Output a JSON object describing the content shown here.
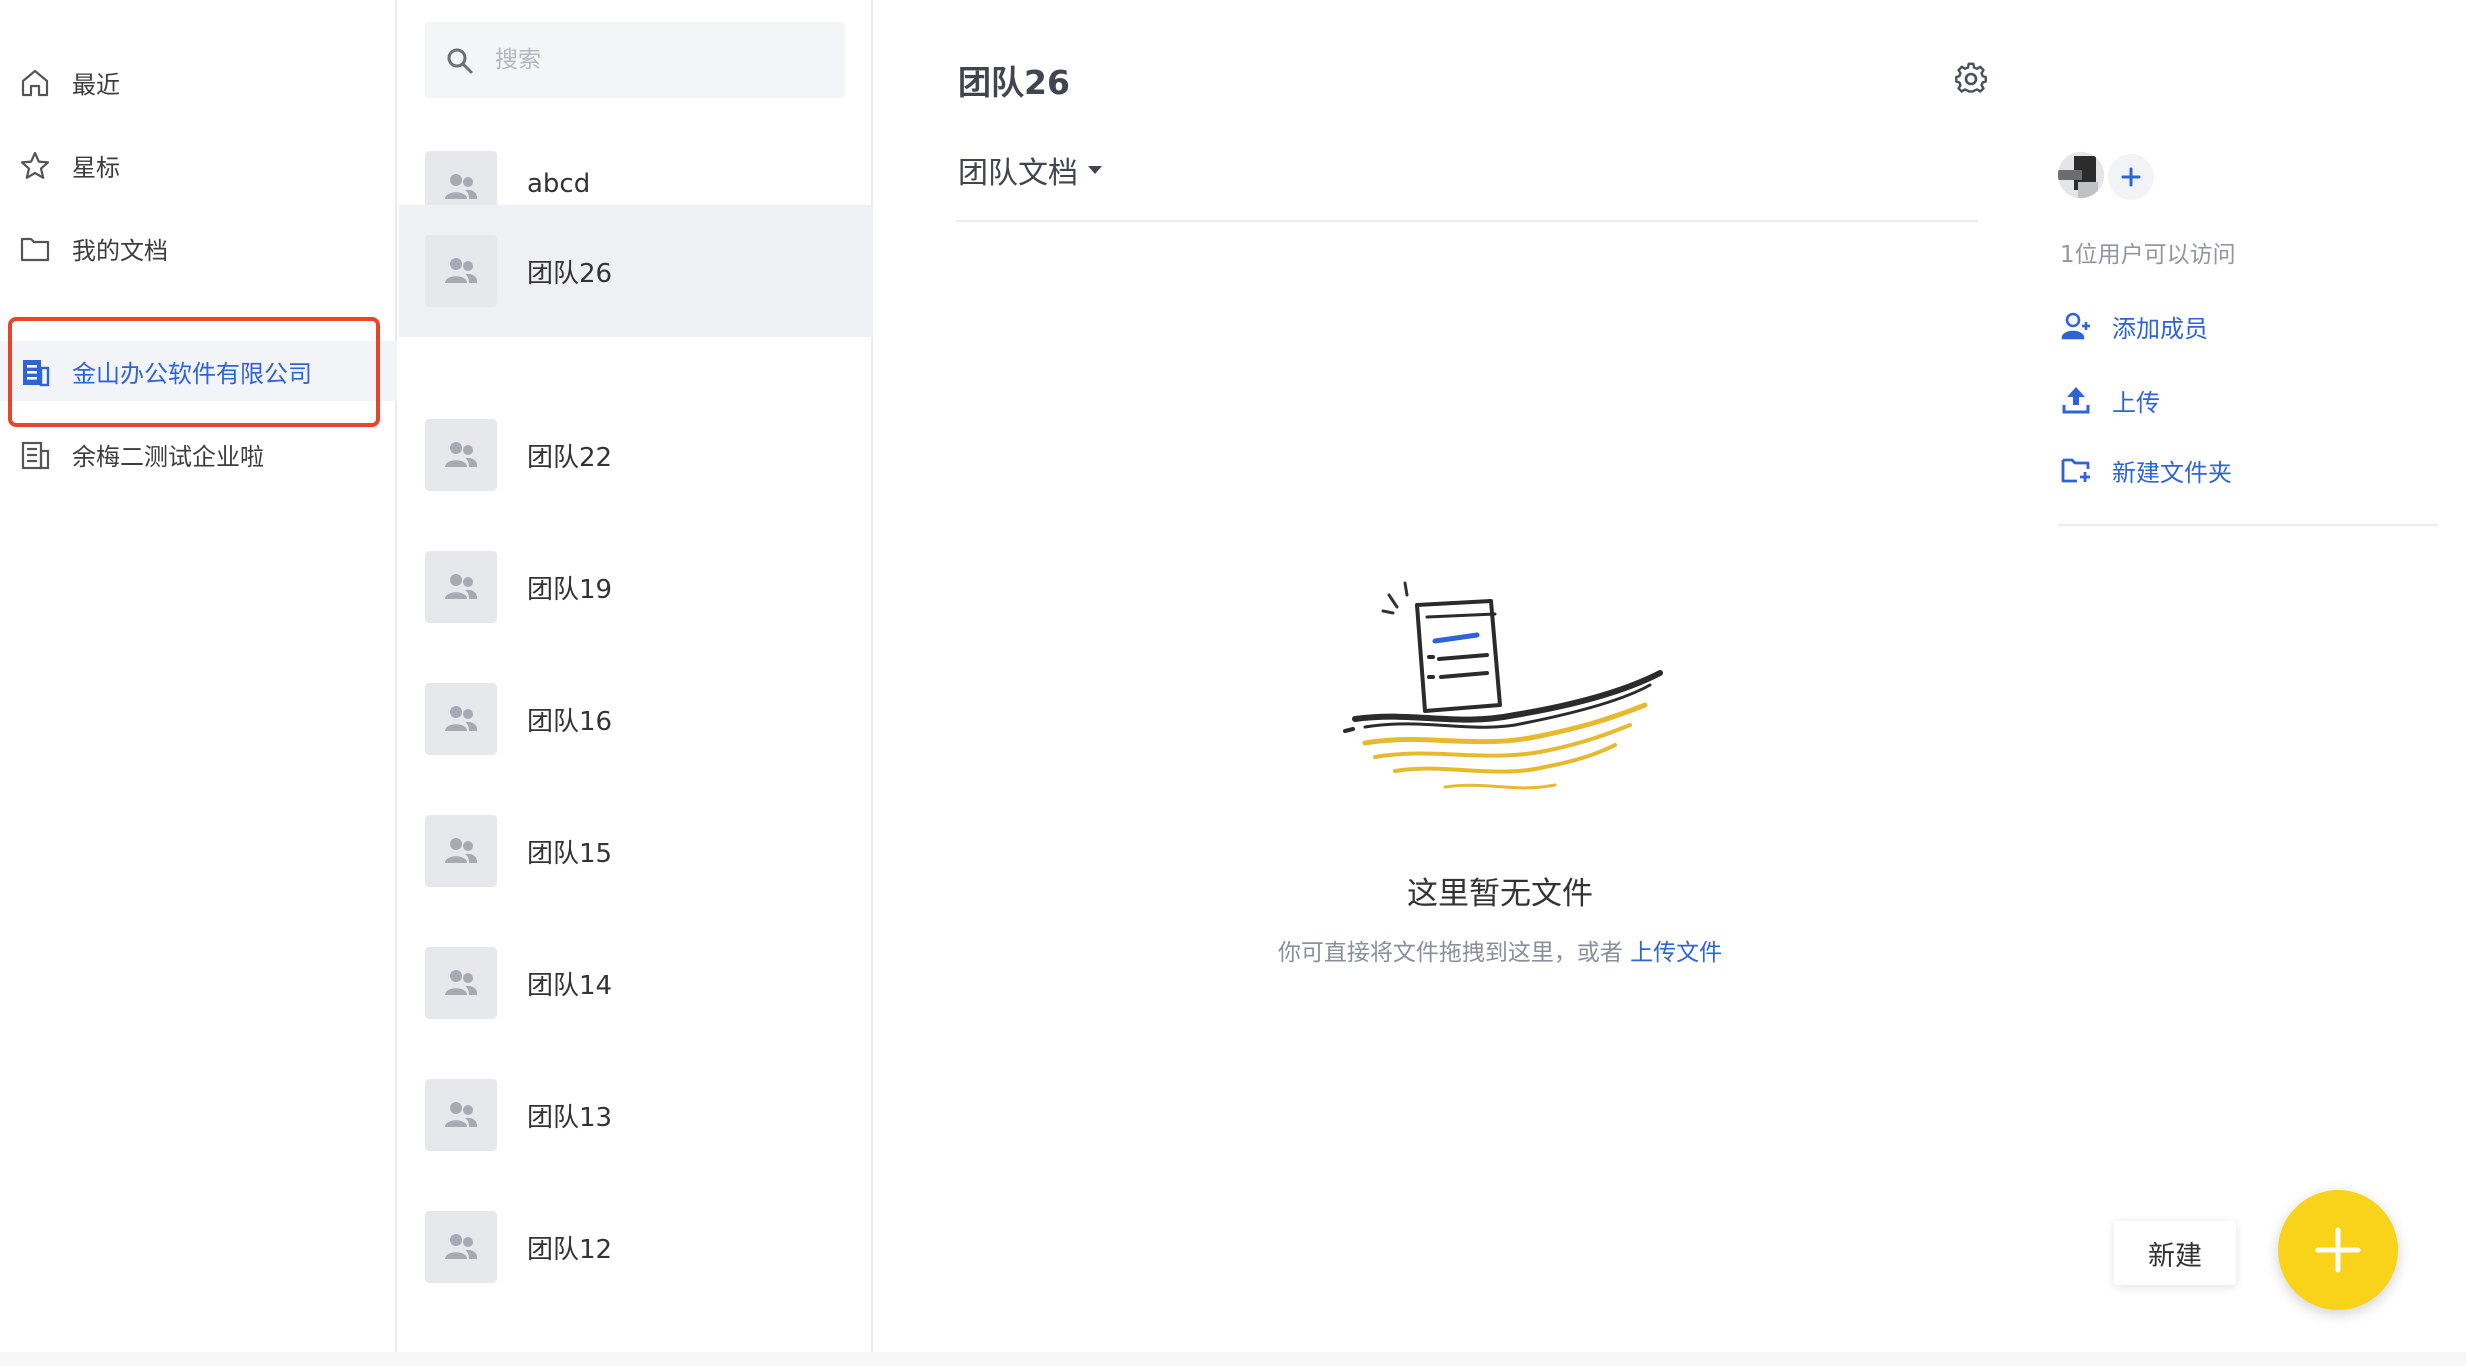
{
  "nav": {
    "items": [
      {
        "label": "最近",
        "icon": "home-icon"
      },
      {
        "label": "星标",
        "icon": "star-icon"
      },
      {
        "label": "我的文档",
        "icon": "folder-icon"
      },
      {
        "label": "金山办公软件有限公司",
        "icon": "building-icon",
        "active": true
      },
      {
        "label": "余梅二测试企业啦",
        "icon": "building-icon"
      }
    ]
  },
  "search": {
    "placeholder": "搜索"
  },
  "teams": [
    {
      "name": "abcd"
    },
    {
      "name": "团队26",
      "active": true
    },
    {
      "name": "团队22"
    },
    {
      "name": "团队19"
    },
    {
      "name": "团队16"
    },
    {
      "name": "团队15"
    },
    {
      "name": "团队14"
    },
    {
      "name": "团队13"
    },
    {
      "name": "团队12"
    }
  ],
  "main": {
    "title": "团队26",
    "doc_dropdown": "团队文档",
    "empty_title": "这里暂无文件",
    "empty_hint": "你可直接将文件拖拽到这里，或者",
    "upload_link": "上传文件"
  },
  "right_panel": {
    "access_text": "1位用户可以访问",
    "actions": {
      "add_member": "添加成员",
      "upload": "上传",
      "new_folder": "新建文件夹"
    }
  },
  "fab": {
    "new_label": "新建"
  },
  "colors": {
    "accent": "#2f64d6",
    "fab": "#f9d21a",
    "highlight": "#e8442c"
  }
}
